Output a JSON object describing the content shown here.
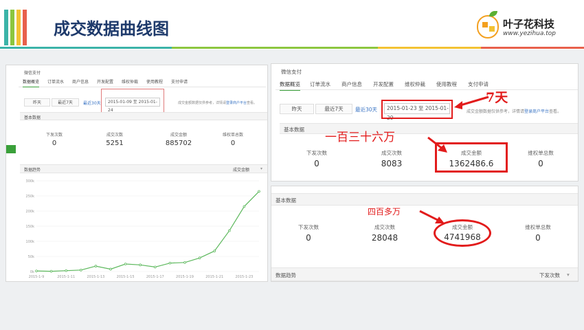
{
  "header": {
    "title": "成交数据曲线图",
    "logo_name": "叶子花科技",
    "logo_url": "www.yezihua.top"
  },
  "panel_a": {
    "app_title": "微信支付",
    "tabs": [
      "数据概览",
      "订单流水",
      "商户信息",
      "开发配置",
      "维权仲裁",
      "使用教程",
      "支付申请"
    ],
    "buttons": [
      "昨天",
      "最近7天",
      "最近30天"
    ],
    "date_range": "2015-01-09 至 2015-01-24",
    "notice": "成交金额数据仅供参考，详情请",
    "notice_link": "登录商户平台",
    "notice_tail": "查看。",
    "basic_data_title": "基本数据",
    "stats": [
      {
        "label": "下发次数",
        "value": "0"
      },
      {
        "label": "成交次数",
        "value": "5251"
      },
      {
        "label": "成交金额",
        "value": "885702"
      },
      {
        "label": "维权单总数",
        "value": "0"
      }
    ],
    "trend_title": "数据趋势",
    "trend_select": "成交金额"
  },
  "panel_b": {
    "app_title": "微信支付",
    "tabs": [
      "数据概览",
      "订单流水",
      "商户信息",
      "开发配置",
      "维权仲裁",
      "使用教程",
      "支付申请"
    ],
    "buttons": [
      "昨天",
      "最近7天",
      "最近30天"
    ],
    "date_range": "2015-01-23 至 2015-01-29",
    "notice": "成交金额数据仅供参考，详情请",
    "notice_link": "登录商户平台",
    "notice_tail": "查看。",
    "basic_data_title": "基本数据",
    "stats": [
      {
        "label": "下发次数",
        "value": "0"
      },
      {
        "label": "成交次数",
        "value": "8083"
      },
      {
        "label": "成交金额",
        "value": "1362486.6"
      },
      {
        "label": "维权单总数",
        "value": "0"
      }
    ],
    "annot_days": "7天",
    "annot_amount": "一百三十六万"
  },
  "panel_c": {
    "basic_data_title": "基本数据",
    "stats": [
      {
        "label": "下发次数",
        "value": "0"
      },
      {
        "label": "成交次数",
        "value": "28048"
      },
      {
        "label": "成交金额",
        "value": "4741968"
      },
      {
        "label": "维权单总数",
        "value": "0"
      }
    ],
    "annot_amount": "四百多万",
    "trend_title": "数据趋势",
    "trend_select": "下发次数"
  },
  "chart_data": {
    "type": "line",
    "title": "",
    "xlabel": "",
    "ylabel": "",
    "ylim": [
      0,
      300000
    ],
    "y_ticks": [
      "0k",
      "50k",
      "100k",
      "150k",
      "200k",
      "250k",
      "300k"
    ],
    "y_tick_values": [
      0,
      50000,
      100000,
      150000,
      200000,
      250000,
      300000
    ],
    "x_ticks": [
      "2015-1-9",
      "2015-1-11",
      "2015-1-13",
      "2015-1-15",
      "2015-1-17",
      "2015-1-19",
      "2015-1-21",
      "2015-1-23"
    ],
    "x": [
      "2015-1-9",
      "2015-1-10",
      "2015-1-11",
      "2015-1-12",
      "2015-1-13",
      "2015-1-14",
      "2015-1-15",
      "2015-1-16",
      "2015-1-17",
      "2015-1-18",
      "2015-1-19",
      "2015-1-20",
      "2015-1-21",
      "2015-1-22",
      "2015-1-23",
      "2015-1-24"
    ],
    "series": [
      {
        "values": [
          2000,
          1000,
          3000,
          5000,
          18000,
          8000,
          25000,
          22000,
          15000,
          28000,
          30000,
          45000,
          68000,
          135000,
          215000,
          265000
        ]
      }
    ],
    "grid": true,
    "color": "#5cb85c"
  }
}
